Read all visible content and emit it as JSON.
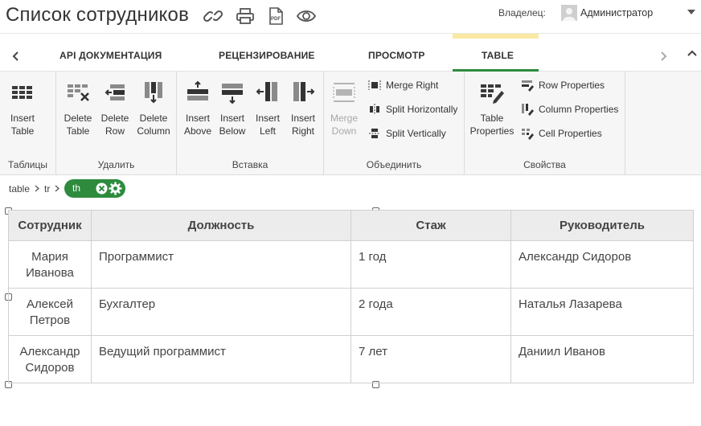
{
  "header": {
    "title": "Список сотрудников",
    "owner_label": "Владелец:",
    "owner_name": "Администратор",
    "icons": [
      "link-icon",
      "print-icon",
      "pdf-icon",
      "eye-icon"
    ],
    "pdf_text": "PDF"
  },
  "tabs": {
    "items": [
      {
        "label": "API ДОКУМЕНТАЦИЯ"
      },
      {
        "label": "РЕЦЕНЗИРОВАНИЕ"
      },
      {
        "label": "ПРОСМОТР"
      },
      {
        "label": "TABLE"
      }
    ],
    "active": "TABLE"
  },
  "ribbon": {
    "groups": {
      "tables": {
        "label": "Таблицы",
        "insert_table": "Insert Table"
      },
      "delete": {
        "label": "Удалить",
        "delete_table": "Delete Table",
        "delete_row": "Delete Row",
        "delete_column": "Delete Column"
      },
      "insert": {
        "label": "Вставка",
        "insert_above": "Insert Above",
        "insert_below": "Insert Below",
        "insert_left": "Insert Left",
        "insert_right": "Insert Right"
      },
      "merge": {
        "label": "Объединить",
        "merge_down": "Merge Down",
        "merge_right": "Merge Right",
        "split_horizontally": "Split Horizontally",
        "split_vertically": "Split Vertically"
      },
      "properties": {
        "label": "Свойства",
        "table_properties": "Table Properties",
        "row_properties": "Row Properties",
        "column_properties": "Column Properties",
        "cell_properties": "Cell Properties"
      }
    }
  },
  "breadcrumb": {
    "items": [
      "table",
      "tr"
    ],
    "current": "th"
  },
  "table": {
    "headers": [
      "Сотрудник",
      "Должность",
      "Стаж",
      "Руководитель"
    ],
    "rows": [
      {
        "name": "Мария Иванова",
        "position": "Программист",
        "experience": "1 год",
        "manager": "Александр Сидоров"
      },
      {
        "name": "Алексей Петров",
        "position": "Бухгалтер",
        "experience": "2 года",
        "manager": "Наталья Лазарева"
      },
      {
        "name": "Александр Сидоров",
        "position": "Ведущий программист",
        "experience": "7 лет",
        "manager": "Даниил Иванов"
      }
    ]
  },
  "colors": {
    "accent": "#2e8b3e",
    "active_tab_marker": "#fbe9a3",
    "ribbon_bg": "#f6f6f6",
    "table_header_bg": "#ececec"
  }
}
